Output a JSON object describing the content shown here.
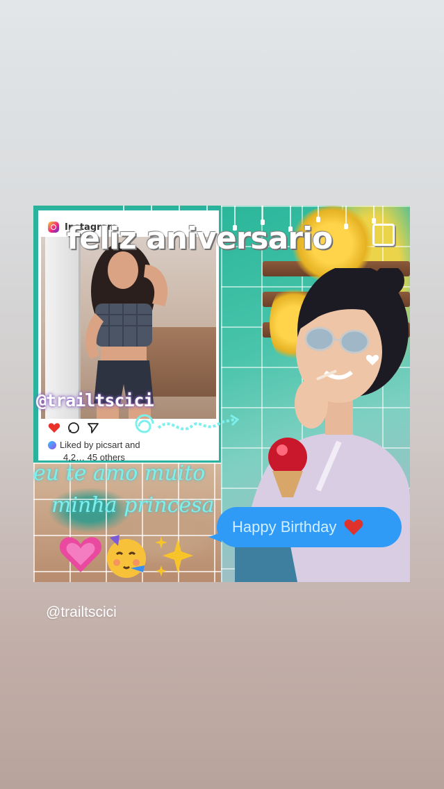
{
  "post": {
    "title": "feliz aniversario",
    "handle_overlay": "@trailtscici",
    "script_line_1": "eu te amo muito",
    "script_line_2": "minha princesa",
    "message_bubble": "Happy Birthday"
  },
  "instagram_card": {
    "brand": "Instagram",
    "liked_by": "Liked by picsart and",
    "others": "4,2… 45 others",
    "icons": [
      "heart-icon",
      "comment-icon",
      "share-icon"
    ]
  },
  "emojis": [
    "growing-heart-emoji",
    "partying-face-emoji",
    "sparkles-emoji"
  ],
  "story": {
    "mention": "@trailtscici"
  },
  "colors": {
    "accent_teal": "#2ab3a2",
    "bubble_blue": "#2f9bf7",
    "script_cyan": "#7cf0ec",
    "handle_glow": "#7b4fb6"
  }
}
